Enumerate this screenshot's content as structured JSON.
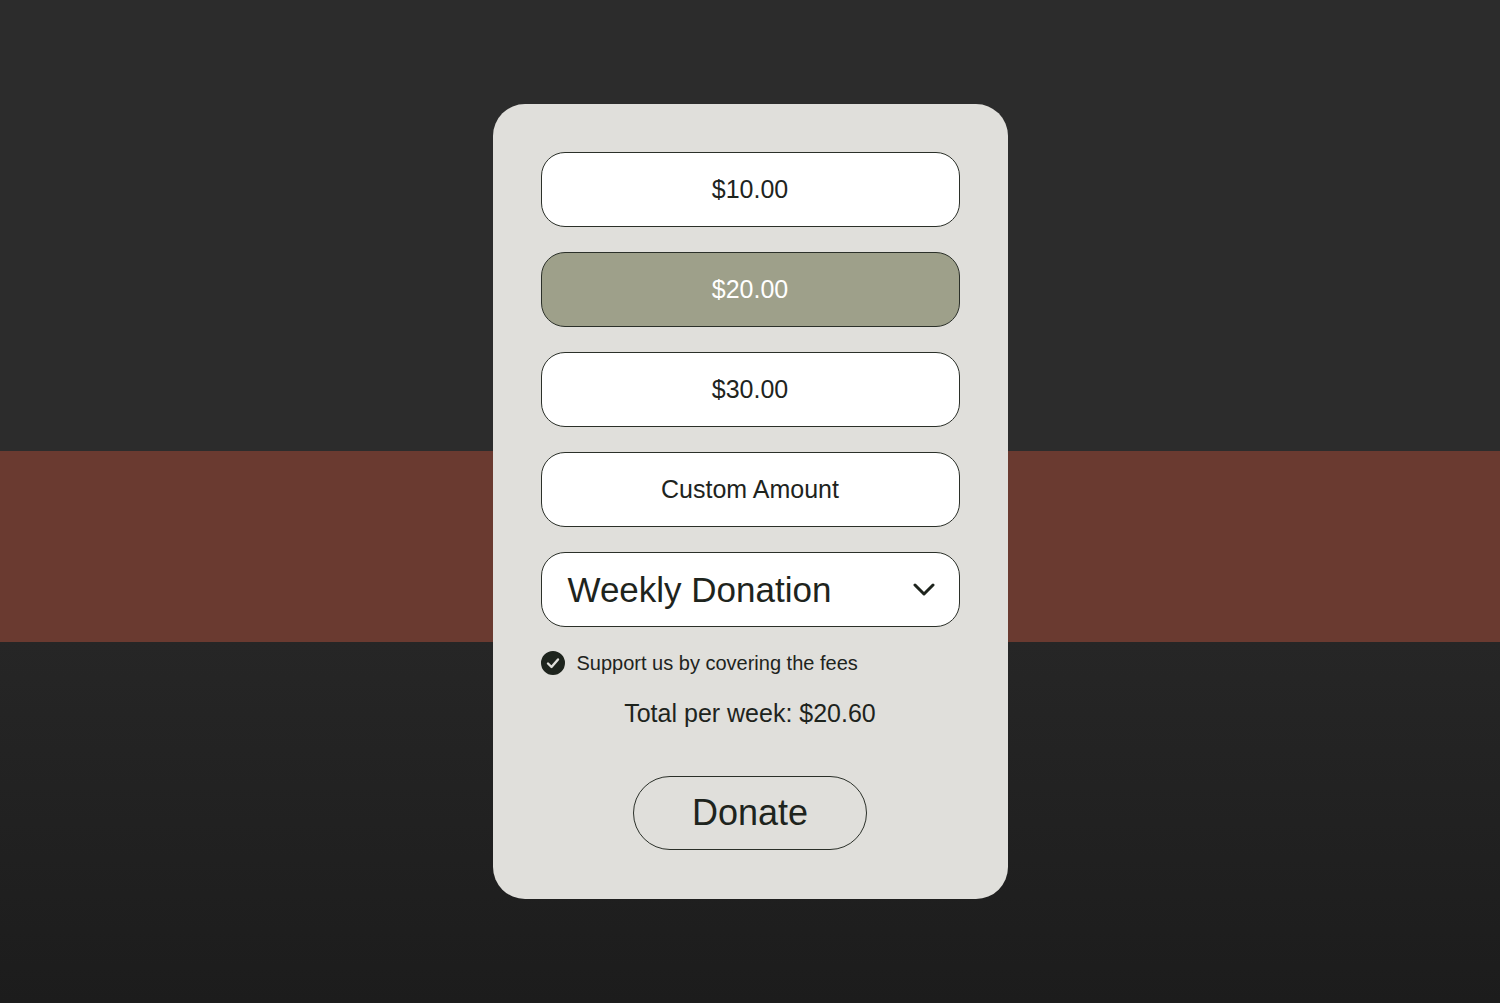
{
  "amounts": [
    {
      "label": "$10.00",
      "selected": false
    },
    {
      "label": "$20.00",
      "selected": true
    },
    {
      "label": "$30.00",
      "selected": false
    },
    {
      "label": "Custom Amount",
      "selected": false
    }
  ],
  "frequency": {
    "value": "Weekly Donation",
    "expanded": false
  },
  "cover_fees": {
    "label": "Support us by covering the fees",
    "checked": true
  },
  "total": "Total per week: $20.60",
  "donate_button": "Donate"
}
